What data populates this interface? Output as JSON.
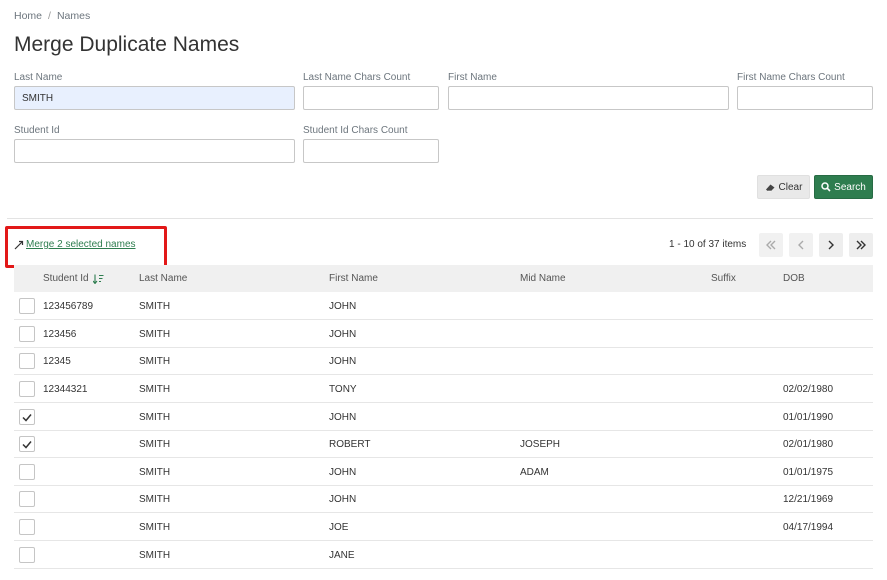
{
  "breadcrumb": {
    "home": "Home",
    "separator": "/",
    "current": "Names"
  },
  "page": {
    "title": "Merge Duplicate Names"
  },
  "filters": {
    "last_name": {
      "label": "Last Name",
      "value": "SMITH"
    },
    "last_name_chars": {
      "label": "Last Name Chars Count",
      "value": ""
    },
    "first_name": {
      "label": "First Name",
      "value": ""
    },
    "first_name_chars": {
      "label": "First Name Chars Count",
      "value": ""
    },
    "student_id": {
      "label": "Student Id",
      "value": ""
    },
    "student_id_chars": {
      "label": "Student Id Chars Count",
      "value": ""
    }
  },
  "actions": {
    "clear_label": "Clear",
    "search_label": "Search",
    "merge_label": "Merge 2 selected names"
  },
  "pager": {
    "info": "1 - 10 of 37 items"
  },
  "grid": {
    "columns": [
      "Student Id",
      "Last Name",
      "First Name",
      "Mid Name",
      "Suffix",
      "DOB"
    ],
    "rows": [
      {
        "checked": false,
        "student_id": "123456789",
        "last_name": "SMITH",
        "first_name": "JOHN",
        "mid_name": "",
        "suffix": "",
        "dob": ""
      },
      {
        "checked": false,
        "student_id": "123456",
        "last_name": "SMITH",
        "first_name": "JOHN",
        "mid_name": "",
        "suffix": "",
        "dob": ""
      },
      {
        "checked": false,
        "student_id": "12345",
        "last_name": "SMITH",
        "first_name": "JOHN",
        "mid_name": "",
        "suffix": "",
        "dob": ""
      },
      {
        "checked": false,
        "student_id": "12344321",
        "last_name": "SMITH",
        "first_name": "TONY",
        "mid_name": "",
        "suffix": "",
        "dob": "02/02/1980"
      },
      {
        "checked": true,
        "student_id": "",
        "last_name": "SMITH",
        "first_name": "JOHN",
        "mid_name": "",
        "suffix": "",
        "dob": "01/01/1990"
      },
      {
        "checked": true,
        "student_id": "",
        "last_name": "SMITH",
        "first_name": "ROBERT",
        "mid_name": "JOSEPH",
        "suffix": "",
        "dob": "02/01/1980"
      },
      {
        "checked": false,
        "student_id": "",
        "last_name": "SMITH",
        "first_name": "JOHN",
        "mid_name": "ADAM",
        "suffix": "",
        "dob": "01/01/1975"
      },
      {
        "checked": false,
        "student_id": "",
        "last_name": "SMITH",
        "first_name": "JOHN",
        "mid_name": "",
        "suffix": "",
        "dob": "12/21/1969"
      },
      {
        "checked": false,
        "student_id": "",
        "last_name": "SMITH",
        "first_name": "JOE",
        "mid_name": "",
        "suffix": "",
        "dob": "04/17/1994"
      },
      {
        "checked": false,
        "student_id": "",
        "last_name": "SMITH",
        "first_name": "JANE",
        "mid_name": "",
        "suffix": "",
        "dob": ""
      }
    ]
  },
  "colors": {
    "accent": "#2e7d4f",
    "highlight": "#e21818",
    "input_fill": "#e8f0fe"
  },
  "icons": {
    "clear": "eraser-icon",
    "search": "search-icon",
    "merge": "merge-icon",
    "sort": "sort-descending-icon",
    "check": "check-icon"
  }
}
